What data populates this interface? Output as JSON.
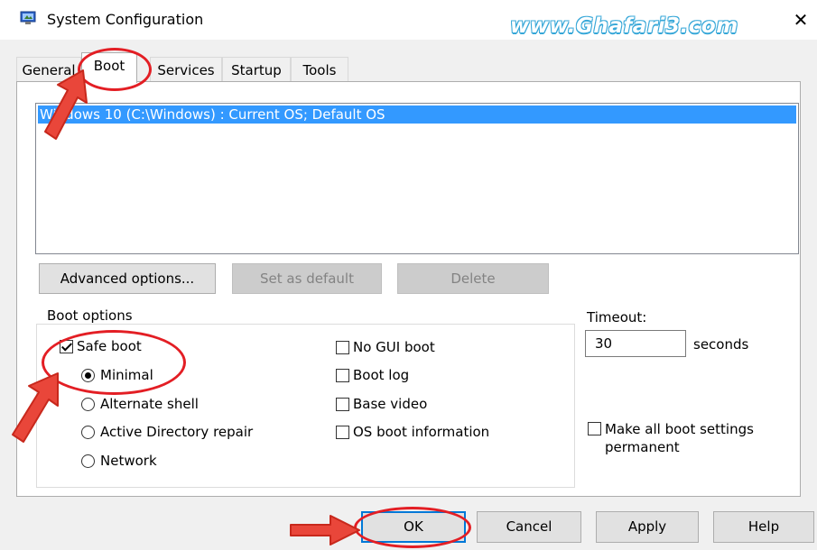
{
  "window": {
    "title": "System Configuration",
    "watermark": "www.Ghafari3.com",
    "close_glyph": "✕"
  },
  "tabs": [
    {
      "label": "General",
      "active": false
    },
    {
      "label": "Boot",
      "active": true
    },
    {
      "label": "Services",
      "active": false
    },
    {
      "label": "Startup",
      "active": false
    },
    {
      "label": "Tools",
      "active": false
    }
  ],
  "os_list": {
    "items": [
      "Windows 10 (C:\\Windows) : Current OS; Default OS"
    ],
    "selected_index": 0
  },
  "list_buttons": {
    "advanced": "Advanced options...",
    "set_default": "Set as default",
    "delete": "Delete"
  },
  "boot_options": {
    "group_label": "Boot options",
    "safe_boot": {
      "label": "Safe boot",
      "checked": true
    },
    "radios": [
      {
        "label": "Minimal",
        "checked": true
      },
      {
        "label": "Alternate shell",
        "checked": false
      },
      {
        "label": "Active Directory repair",
        "checked": false
      },
      {
        "label": "Network",
        "checked": false
      }
    ],
    "checks": [
      {
        "label": "No GUI boot",
        "checked": false
      },
      {
        "label": "Boot log",
        "checked": false
      },
      {
        "label": "Base video",
        "checked": false
      },
      {
        "label": "OS boot information",
        "checked": false
      }
    ]
  },
  "timeout": {
    "label": "Timeout:",
    "value": "30",
    "unit": "seconds"
  },
  "permanent": {
    "label_line1": "Make all boot settings",
    "label_line2": "permanent",
    "checked": false
  },
  "footer_buttons": {
    "ok": "OK",
    "cancel": "Cancel",
    "apply": "Apply",
    "help": "Help"
  },
  "colors": {
    "selection": "#3399ff",
    "annotation": "#e31e24",
    "watermark": "#36a7d8"
  }
}
